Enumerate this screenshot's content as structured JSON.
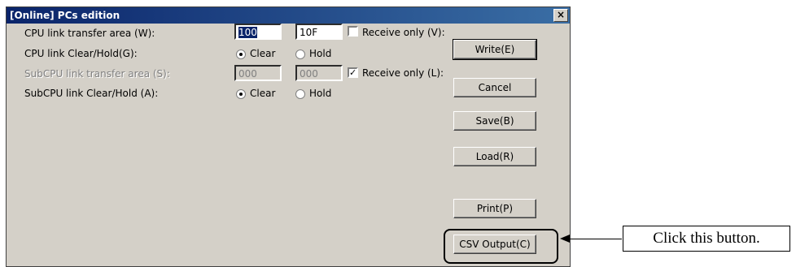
{
  "dialog": {
    "title": "[Online] PCs edition",
    "close_glyph": "×"
  },
  "form": {
    "cpu_transfer_label": "CPU link transfer area (W):",
    "cpu_transfer_start": "100",
    "cpu_transfer_end": "10F",
    "cpu_receive_only_label": "Receive only (V):",
    "cpu_receive_only_checked": false,
    "cpu_clear_hold_label": "CPU link Clear/Hold(G):",
    "cpu_clear_label": "Clear",
    "cpu_hold_label": "Hold",
    "sub_transfer_label": "SubCPU link transfer area (S):",
    "sub_transfer_start": "000",
    "sub_transfer_end": "000",
    "sub_receive_only_label": "Receive only (L):",
    "sub_receive_only_checked": true,
    "sub_clear_hold_label": "SubCPU link Clear/Hold (A):",
    "sub_clear_label": "Clear",
    "sub_hold_label": "Hold"
  },
  "buttons": {
    "write": "Write(E)",
    "cancel": "Cancel",
    "save": "Save(B)",
    "load": "Load(R)",
    "print": "Print(P)",
    "csv_output": "CSV Output(C)"
  },
  "annotation": {
    "callout_text": "Click this button."
  }
}
